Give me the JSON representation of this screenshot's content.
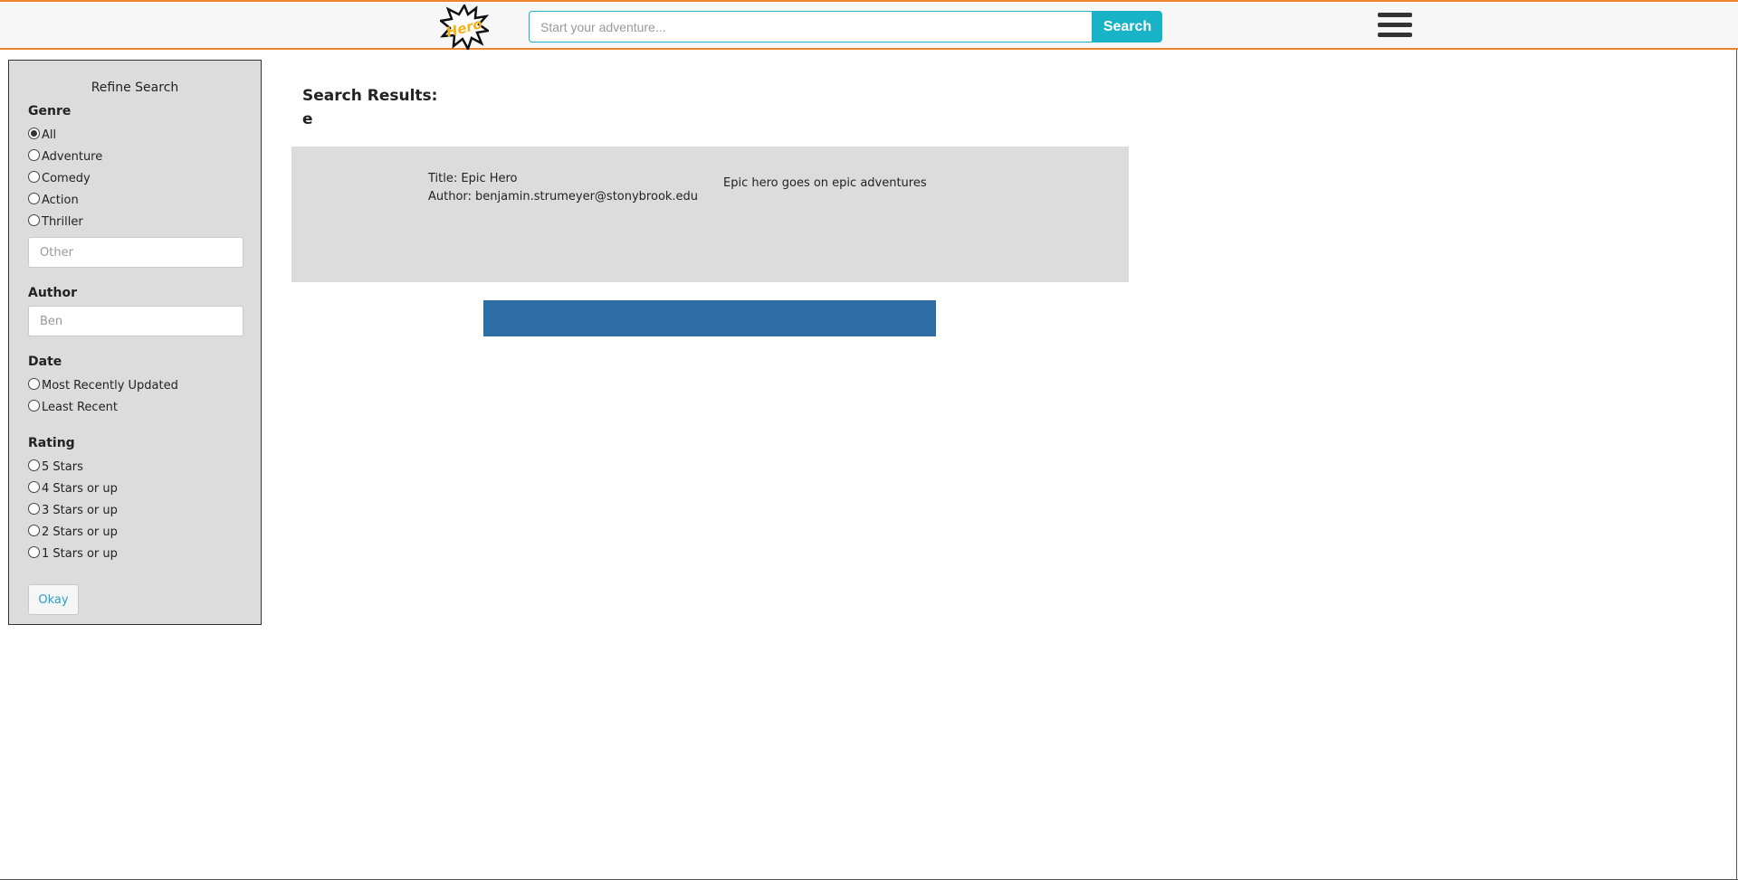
{
  "header": {
    "logo_text": "Hero",
    "search_placeholder": "Start your adventure...",
    "search_button": "Search",
    "menu_icon": "hamburger-icon"
  },
  "sidebar": {
    "title": "Refine Search",
    "genre": {
      "label": "Genre",
      "options": [
        "All",
        "Adventure",
        "Comedy",
        "Action",
        "Thriller"
      ],
      "selected": "All",
      "other_placeholder": "Other"
    },
    "author": {
      "label": "Author",
      "placeholder": "Ben"
    },
    "date": {
      "label": "Date",
      "options": [
        "Most Recently Updated",
        "Least Recent"
      ]
    },
    "rating": {
      "label": "Rating",
      "options": [
        "5 Stars",
        "4 Stars or up",
        "3 Stars or up",
        "2 Stars or up",
        "1 Stars or up"
      ]
    },
    "okay_button": "Okay"
  },
  "results": {
    "heading": "Search Results:",
    "query": "e",
    "items": [
      {
        "title": "Title: Epic Hero",
        "author": "Author: benjamin.strumeyer@stonybrook.edu",
        "description": "Epic hero goes on epic adventures"
      }
    ]
  },
  "colors": {
    "accent": "#f0822a",
    "search": "#19b3c7",
    "bar": "#2d6ca4",
    "panel": "#dcdcdc"
  }
}
